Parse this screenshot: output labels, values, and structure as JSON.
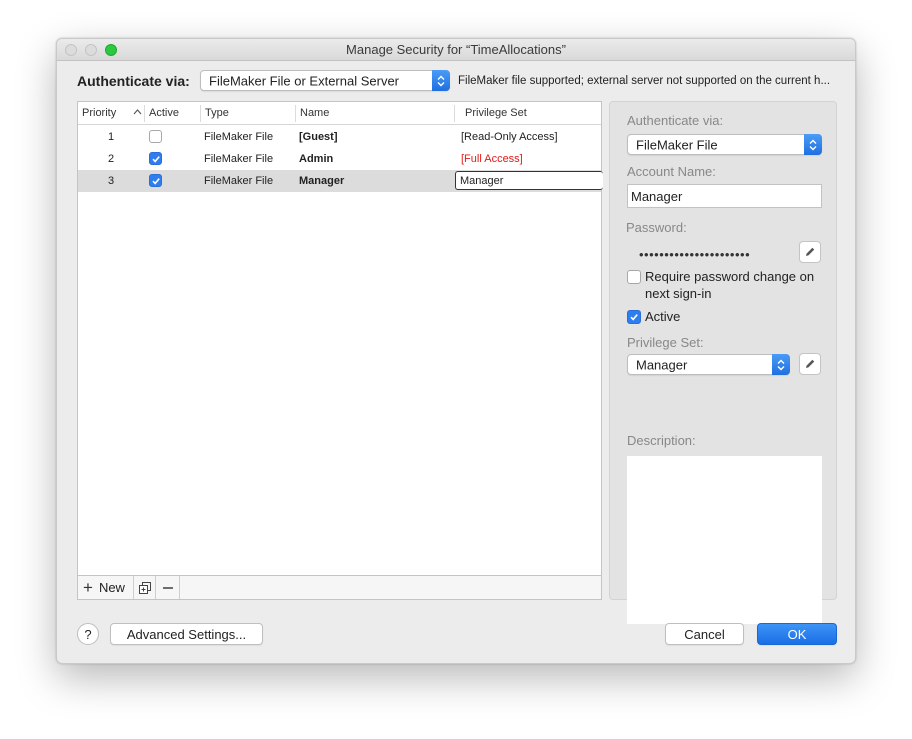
{
  "window": {
    "title": "Manage Security for “TimeAllocations”"
  },
  "auth": {
    "label": "Authenticate via:",
    "selected": "FileMaker File or External Server",
    "note": "FileMaker file supported; external server not supported on the current h..."
  },
  "table": {
    "columns": {
      "priority": "Priority",
      "active": "Active",
      "type": "Type",
      "name": "Name",
      "privilege": "Privilege Set"
    },
    "rows": [
      {
        "priority": "1",
        "active": false,
        "type": "FileMaker File",
        "name": "[Guest]",
        "privilege": "[Read-Only Access]"
      },
      {
        "priority": "2",
        "active": true,
        "type": "FileMaker File",
        "name": "Admin",
        "privilege": "[Full Access]"
      },
      {
        "priority": "3",
        "active": true,
        "type": "FileMaker File",
        "name": "Manager",
        "privilege": "Manager"
      }
    ],
    "footer": {
      "new_label": "New"
    }
  },
  "details": {
    "auth_label": "Authenticate via:",
    "auth_value": "FileMaker File",
    "account_label": "Account Name:",
    "account_value": "Manager",
    "password_label": "Password:",
    "password_mask": "••••••••••••••••••••••",
    "require_change_label": "Require password change on next sign-in",
    "require_change_checked": false,
    "active_label": "Active",
    "active_checked": true,
    "privilege_label": "Privilege Set:",
    "privilege_value": "Manager",
    "description_label": "Description:"
  },
  "buttons": {
    "help": "?",
    "advanced": "Advanced Settings...",
    "cancel": "Cancel",
    "ok": "OK"
  },
  "colors": {
    "accent": "#2f7ef0",
    "full_access": "#e01a1a"
  }
}
